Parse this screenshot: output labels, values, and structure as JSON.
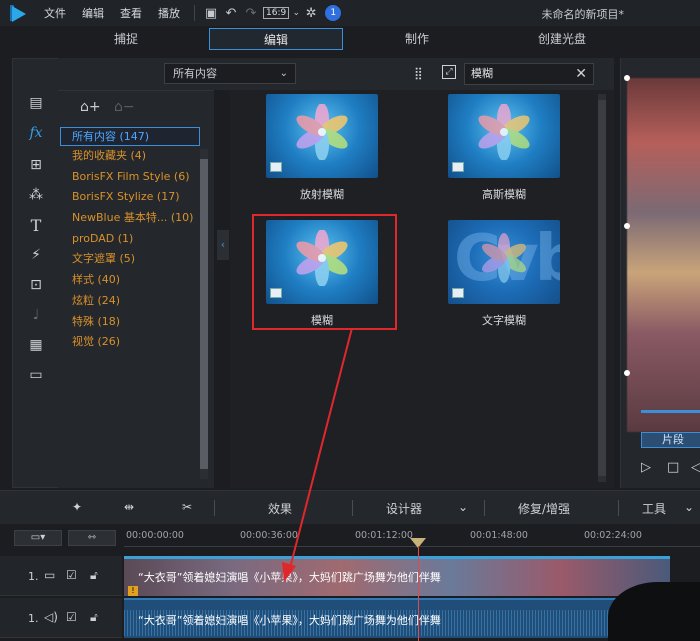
{
  "menubar": {
    "items": [
      "文件",
      "编辑",
      "查看",
      "播放"
    ],
    "ratio": "16:9",
    "bell": "1",
    "project_title": "未命名的新项目*"
  },
  "modes": {
    "tabs": [
      "捕捉",
      "编辑",
      "制作",
      "创建光盘"
    ],
    "active": "编辑"
  },
  "filter": {
    "dropdown_value": "所有内容",
    "search_value": "模糊"
  },
  "categories": [
    {
      "label": "所有内容 (147)",
      "selected": true
    },
    {
      "label": "我的收藏夹 (4)"
    },
    {
      "label": "BorisFX Film Style (6)"
    },
    {
      "label": "BorisFX Stylize (17)"
    },
    {
      "label": "NewBlue 基本特... (10)"
    },
    {
      "label": "proDAD (1)"
    },
    {
      "label": "文字遮罩 (5)"
    },
    {
      "label": "样式 (40)"
    },
    {
      "label": "炫粒 (24)"
    },
    {
      "label": "特殊 (18)"
    },
    {
      "label": "视觉 (26)"
    }
  ],
  "effects": [
    {
      "label": "放射模糊"
    },
    {
      "label": "高斯模糊"
    },
    {
      "label": "模糊",
      "highlighted": true
    },
    {
      "label": "文字模糊"
    }
  ],
  "preview": {
    "segment_label": "片段"
  },
  "toolbar": {
    "effect": "效果",
    "designer": "设计器",
    "repair": "修复/增强",
    "tools": "工具"
  },
  "timeline": {
    "ticks": [
      "00:00:00:00",
      "00:00:36:00",
      "00:01:12:00",
      "00:01:48:00",
      "00:02:24:00"
    ],
    "video_track": {
      "num": "1.",
      "clip_title": "“大衣哥”领着媳妇演唱《小苹果》，大妈们跳广场舞为他们伴舞"
    },
    "audio_track": {
      "num": "1.",
      "clip_title": "“大衣哥”领着媳妇演唱《小苹果》，大妈们跳广场舞为他们伴舞"
    }
  },
  "colors": {
    "accent": "#3a8fd8",
    "category_text": "#d9922a",
    "highlight_box": "#e0282c"
  }
}
